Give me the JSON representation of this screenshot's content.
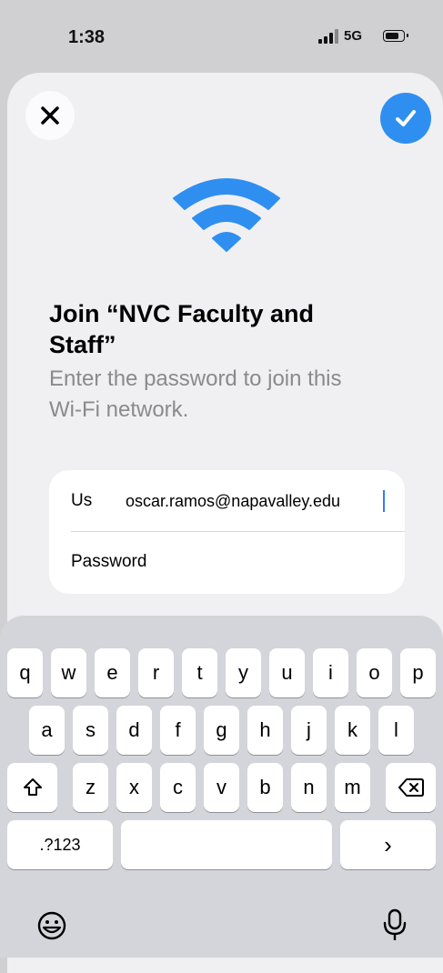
{
  "status_bar": {
    "time": "1:38",
    "network": "5G"
  },
  "dialog": {
    "title": "Join “NVC Faculty and Staff”",
    "subtitle": "Enter the password to join this Wi-Fi network.",
    "username_label": "Us",
    "username_value": "oscar.ramos@napavalley.edu",
    "password_label": "Password"
  },
  "keyboard": {
    "row1": [
      "q",
      "w",
      "e",
      "r",
      "t",
      "y",
      "u",
      "i",
      "o",
      "p"
    ],
    "row2": [
      "a",
      "s",
      "d",
      "f",
      "g",
      "h",
      "j",
      "k",
      "l"
    ],
    "row3": [
      "z",
      "x",
      "c",
      "v",
      "b",
      "n",
      "m"
    ],
    "numbers_key": ".?123",
    "return_key": "›",
    "space_key": ""
  },
  "icons": {
    "close": "close-icon",
    "confirm": "checkmark-icon",
    "wifi": "wifi-icon",
    "shift": "shift-icon",
    "delete": "delete-icon",
    "emoji": "emoji-icon",
    "mic": "microphone-icon"
  },
  "colors": {
    "accent": "#2f8ff0",
    "wifi_blue": "#2f8ff0"
  }
}
